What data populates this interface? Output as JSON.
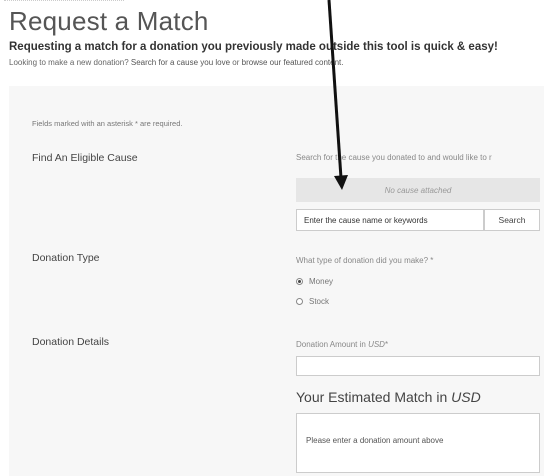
{
  "header": {
    "title": "Request a Match",
    "intro": "Requesting a match for a donation you previously made outside this tool is quick & easy!",
    "sub_intro_prefix": "Looking to make a new donation?",
    "sub_intro_link1": "Search for a cause you love",
    "sub_intro_or": "or",
    "sub_intro_link2": "browse our featured content."
  },
  "form": {
    "required_note": "Fields marked with an asterisk * are required.",
    "cause": {
      "label": "Find An Eligible Cause",
      "help": "Search for the cause you donated to and would like to r",
      "attached_text": "No cause attached",
      "search_placeholder": "Enter the cause name or keywords",
      "search_button": "Search"
    },
    "donation_type": {
      "label": "Donation Type",
      "question": "What type of donation did you make? *",
      "options": [
        {
          "label": "Money",
          "selected": true
        },
        {
          "label": "Stock",
          "selected": false
        }
      ]
    },
    "details": {
      "label": "Donation Details",
      "amount_label_prefix": "Donation Amount in",
      "currency": "USD",
      "required_mark": "*",
      "amount_value": "",
      "estimate_heading_prefix": "Your Estimated Match in",
      "estimate_text": "Please enter a donation amount above"
    }
  },
  "annotation": {
    "arrow_color": "#111111"
  }
}
